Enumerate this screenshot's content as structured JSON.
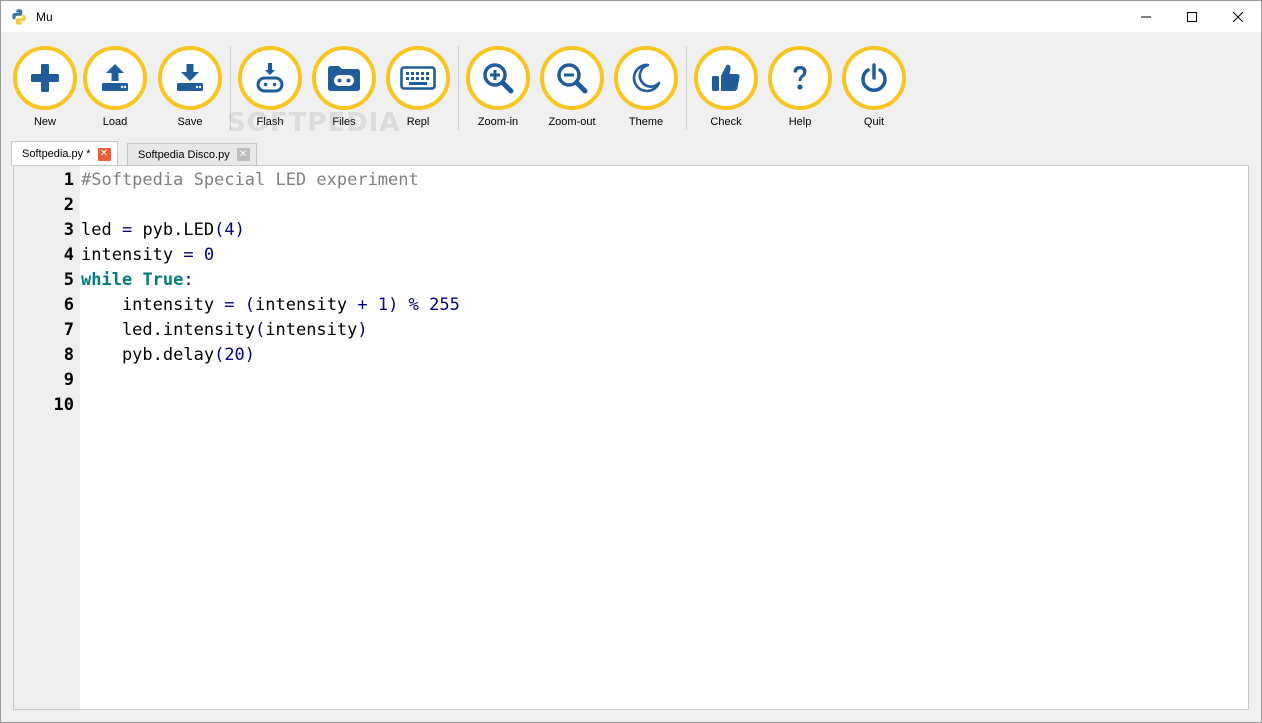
{
  "window": {
    "title": "Mu"
  },
  "theme": {
    "accent": "#f9c522",
    "icon_color": "#1f5c99"
  },
  "toolbar": {
    "buttons": [
      {
        "id": "new",
        "label": "New",
        "icon": "plus-icon"
      },
      {
        "id": "load",
        "label": "Load",
        "icon": "upload-icon"
      },
      {
        "id": "save",
        "label": "Save",
        "icon": "download-icon"
      },
      {
        "id": "flash",
        "label": "Flash",
        "icon": "flash-device-icon"
      },
      {
        "id": "files",
        "label": "Files",
        "icon": "microbit-icon"
      },
      {
        "id": "repl",
        "label": "Repl",
        "icon": "keyboard-icon"
      },
      {
        "id": "zoom-in",
        "label": "Zoom-in",
        "icon": "zoom-in-icon"
      },
      {
        "id": "zoom-out",
        "label": "Zoom-out",
        "icon": "zoom-out-icon"
      },
      {
        "id": "theme",
        "label": "Theme",
        "icon": "moon-icon"
      },
      {
        "id": "check",
        "label": "Check",
        "icon": "thumbs-up-icon"
      },
      {
        "id": "help",
        "label": "Help",
        "icon": "question-icon"
      },
      {
        "id": "quit",
        "label": "Quit",
        "icon": "power-icon"
      }
    ]
  },
  "watermark": "SOFTPEDIA",
  "tabs": [
    {
      "label": "Softpedia.py *",
      "active": true,
      "close": "✕"
    },
    {
      "label": "Softpedia Disco.py",
      "active": false,
      "close": "✕"
    }
  ],
  "editor": {
    "line_numbers": [
      "1",
      "2",
      "3",
      "4",
      "5",
      "6",
      "7",
      "8",
      "9",
      "10"
    ],
    "lines": [
      [
        {
          "t": "#Softpedia Special LED experiment",
          "c": "comment"
        }
      ],
      [],
      [
        {
          "t": "led ",
          "c": ""
        },
        {
          "t": "=",
          "c": "op"
        },
        {
          "t": " pyb.LED",
          "c": ""
        },
        {
          "t": "(",
          "c": "op"
        },
        {
          "t": "4",
          "c": "number"
        },
        {
          "t": ")",
          "c": "op"
        }
      ],
      [
        {
          "t": "intensity ",
          "c": ""
        },
        {
          "t": "=",
          "c": "op"
        },
        {
          "t": " ",
          "c": ""
        },
        {
          "t": "0",
          "c": "number"
        }
      ],
      [
        {
          "t": "while",
          "c": "keyword"
        },
        {
          "t": " ",
          "c": ""
        },
        {
          "t": "True",
          "c": "keyword"
        },
        {
          "t": ":",
          "c": "op"
        }
      ],
      [
        {
          "t": "    intensity ",
          "c": ""
        },
        {
          "t": "=",
          "c": "op"
        },
        {
          "t": " ",
          "c": ""
        },
        {
          "t": "(",
          "c": "op"
        },
        {
          "t": "intensity ",
          "c": ""
        },
        {
          "t": "+",
          "c": "op"
        },
        {
          "t": " ",
          "c": ""
        },
        {
          "t": "1",
          "c": "number"
        },
        {
          "t": ")",
          "c": "op"
        },
        {
          "t": " ",
          "c": ""
        },
        {
          "t": "%",
          "c": "op"
        },
        {
          "t": " ",
          "c": ""
        },
        {
          "t": "255",
          "c": "number"
        }
      ],
      [
        {
          "t": "    led.intensity",
          "c": ""
        },
        {
          "t": "(",
          "c": "op"
        },
        {
          "t": "intensity",
          "c": ""
        },
        {
          "t": ")",
          "c": "op"
        }
      ],
      [
        {
          "t": "    pyb.delay",
          "c": ""
        },
        {
          "t": "(",
          "c": "op"
        },
        {
          "t": "20",
          "c": "number"
        },
        {
          "t": ")",
          "c": "op"
        }
      ],
      [],
      []
    ]
  }
}
